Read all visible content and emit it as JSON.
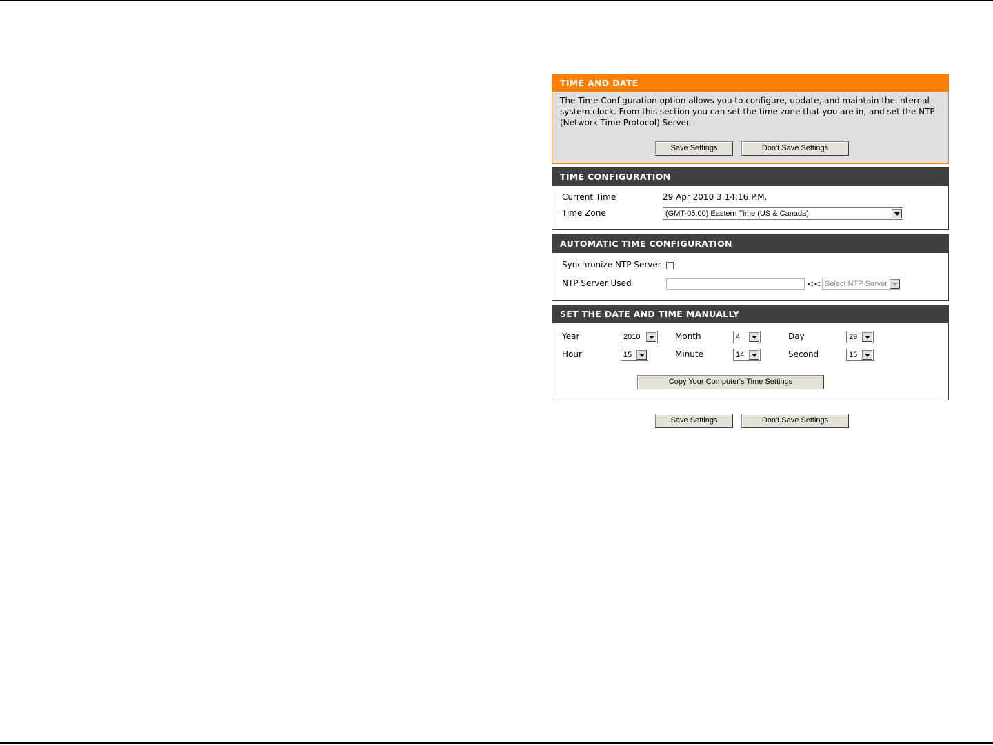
{
  "intro": {
    "title": "TIME AND DATE",
    "description": "The Time Configuration option allows you to configure, update, and maintain the internal system clock. From this section you can set the time zone that you are in, and set the NTP (Network Time Protocol) Server.",
    "save_label": "Save Settings",
    "dont_save_label": "Don't Save Settings"
  },
  "time_config": {
    "title": "TIME CONFIGURATION",
    "current_time_label": "Current Time",
    "current_time_value": "29 Apr 2010 3:14:16 P.M.",
    "time_zone_label": "Time Zone",
    "time_zone_value": "(GMT-05:00) Eastern Time (US & Canada)"
  },
  "auto_time": {
    "title": "AUTOMATIC TIME CONFIGURATION",
    "sync_label": "Synchronize NTP Server",
    "sync_checked": false,
    "server_label": "NTP Server Used",
    "server_value": "",
    "arrow_text": "<<",
    "server_select_value": "Select NTP Server"
  },
  "manual": {
    "title": "SET THE DATE AND TIME MANUALLY",
    "year_label": "Year",
    "year_value": "2010",
    "month_label": "Month",
    "month_value": "4",
    "day_label": "Day",
    "day_value": "29",
    "hour_label": "Hour",
    "hour_value": "15",
    "minute_label": "Minute",
    "minute_value": "14",
    "second_label": "Second",
    "second_value": "15",
    "copy_label": "Copy Your Computer's Time Settings"
  },
  "footer": {
    "save_label": "Save Settings",
    "dont_save_label": "Don't Save Settings"
  }
}
